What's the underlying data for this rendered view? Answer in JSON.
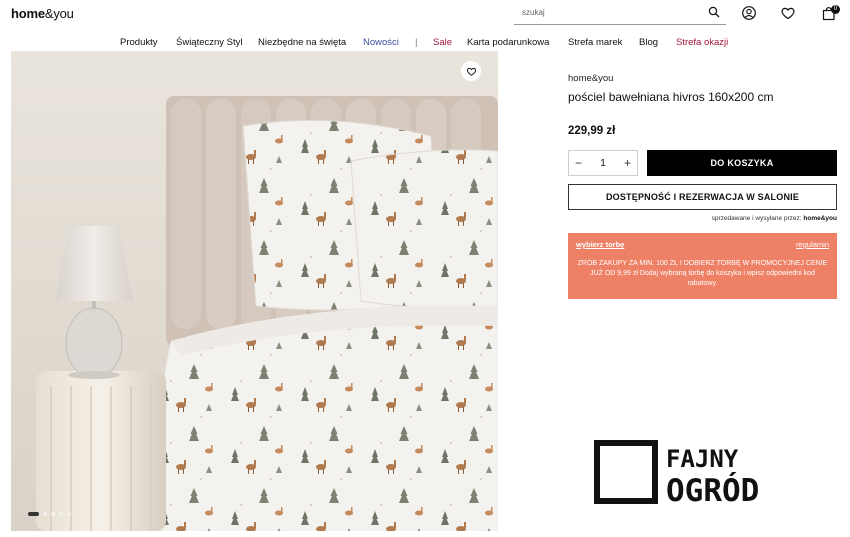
{
  "header": {
    "logo_main": "home",
    "logo_amp": "&you",
    "search_placeholder": "szukaj",
    "cart_count": "0",
    "icons": [
      "search-icon",
      "user-icon",
      "heart-icon",
      "cart-icon"
    ]
  },
  "nav": {
    "items": [
      {
        "label": "Produkty"
      },
      {
        "label": "Świąteczny Styl"
      },
      {
        "label": "Niezbędne na święta"
      },
      {
        "label": "Nowości"
      },
      {
        "label": "|"
      },
      {
        "label": "Sale"
      },
      {
        "label": "Karta podarunkowa"
      },
      {
        "label": "Strefa marek"
      },
      {
        "label": "Blog"
      },
      {
        "label": "Strefa okazji"
      }
    ]
  },
  "gallery": {
    "slides": 5,
    "active_slide": 1
  },
  "product": {
    "brand": "home&you",
    "title": "pościel bawełniana hivros 160x200 cm",
    "price": "229,99 zł",
    "quantity": "1",
    "add_to_cart": "DO KOSZYKA",
    "availability": "DOSTĘPNOŚĆ I REZERWACJA W SALONIE",
    "sold_by_prefix": "sprzedawane i wysyłane przez:",
    "sold_by_name": "home&you"
  },
  "promo": {
    "choose_label": "wybierz torbę",
    "rules_label": "regulamin",
    "text": "ZRÓB ZAKUPY ZA MIN. 100 ZŁ I DOBIERZ TORBĘ W PROMOCYJNEJ CENIE JUŻ OD 9,99 zł Dodaj wybraną torbę do koszyka i wpisz odpowiedni kod rabatowy."
  },
  "watermark": {
    "line1": "FAJNY",
    "line2": "OGRÓD"
  },
  "colors": {
    "accent_blue": "#3d4ea1",
    "accent_red": "#a3173a",
    "promo_bg": "#ee8066",
    "button_black": "#000000"
  }
}
